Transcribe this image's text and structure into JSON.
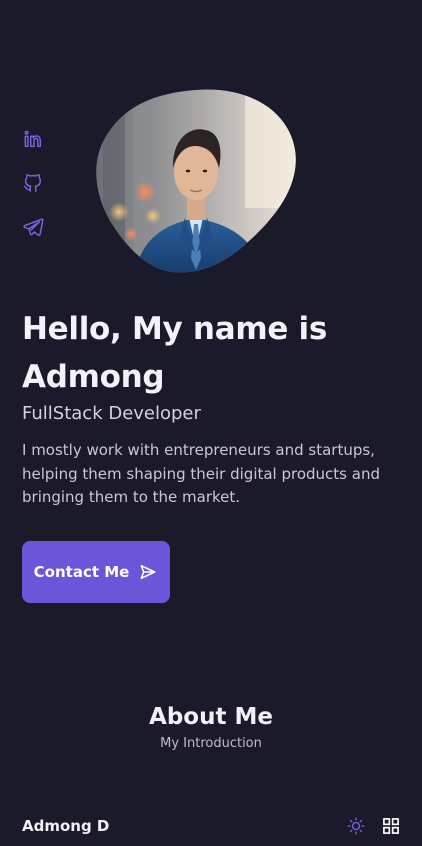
{
  "social": {
    "items": [
      {
        "icon": "linkedin-icon"
      },
      {
        "icon": "github-icon"
      },
      {
        "icon": "telegram-icon"
      }
    ]
  },
  "hero": {
    "title": "Hello, My name is Admong",
    "subtitle": "FullStack Developer",
    "description": "I mostly work with entrepreneurs and startups, helping them shaping their digital products and bringing them to the market.",
    "contact_label": "Contact Me",
    "contact_icon": "send-icon"
  },
  "about": {
    "title": "About Me",
    "subtitle": "My Introduction"
  },
  "nav": {
    "brand": "Admong D",
    "theme_icon": "sun-icon",
    "menu_icon": "grid-menu-icon"
  },
  "colors": {
    "background": "#1b1a2b",
    "accent": "#6c55d9",
    "icon_accent": "#7b62e3",
    "text_primary": "#f1f0f7",
    "text_secondary": "#c9c7d4"
  }
}
